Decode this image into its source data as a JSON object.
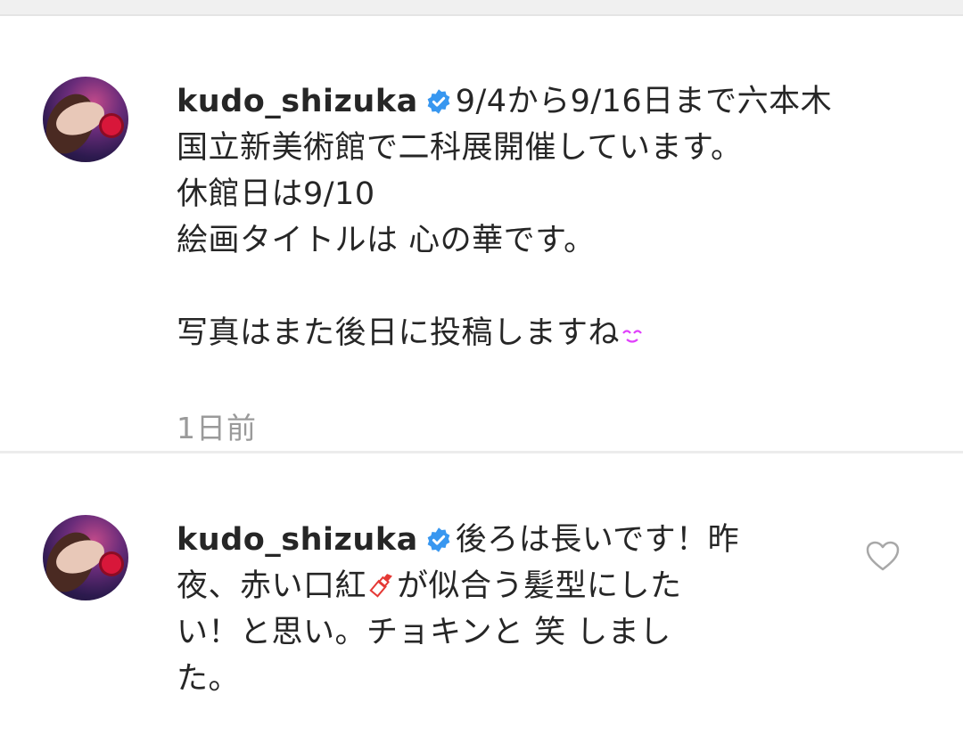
{
  "comments": [
    {
      "username": "kudo_shizuka",
      "verified": true,
      "lines": [
        "9/4から9/16日まで六本木",
        "国立新美術館で二科展開催しています。",
        "休館日は9/10",
        "絵画タイトルは 心の華です。",
        "",
        "写真はまた後日に投稿しますね"
      ],
      "trailing_emoji": "smiling-eyes-emoji",
      "timestamp": "1日前"
    },
    {
      "username": "kudo_shizuka",
      "verified": true,
      "lines": [
        "後ろは長いです！昨",
        "夜、赤い口紅",
        "が似合う髪型にした",
        "い！と思い。チョキンと 笑 しまし",
        "た。"
      ],
      "inline_emoji": "lipstick-emoji",
      "like_icon": "heart-outline-icon"
    }
  ],
  "colors": {
    "text": "#262626",
    "secondary": "#9a9a9a",
    "verified_badge": "#3897f0",
    "divider": "#ececec"
  }
}
